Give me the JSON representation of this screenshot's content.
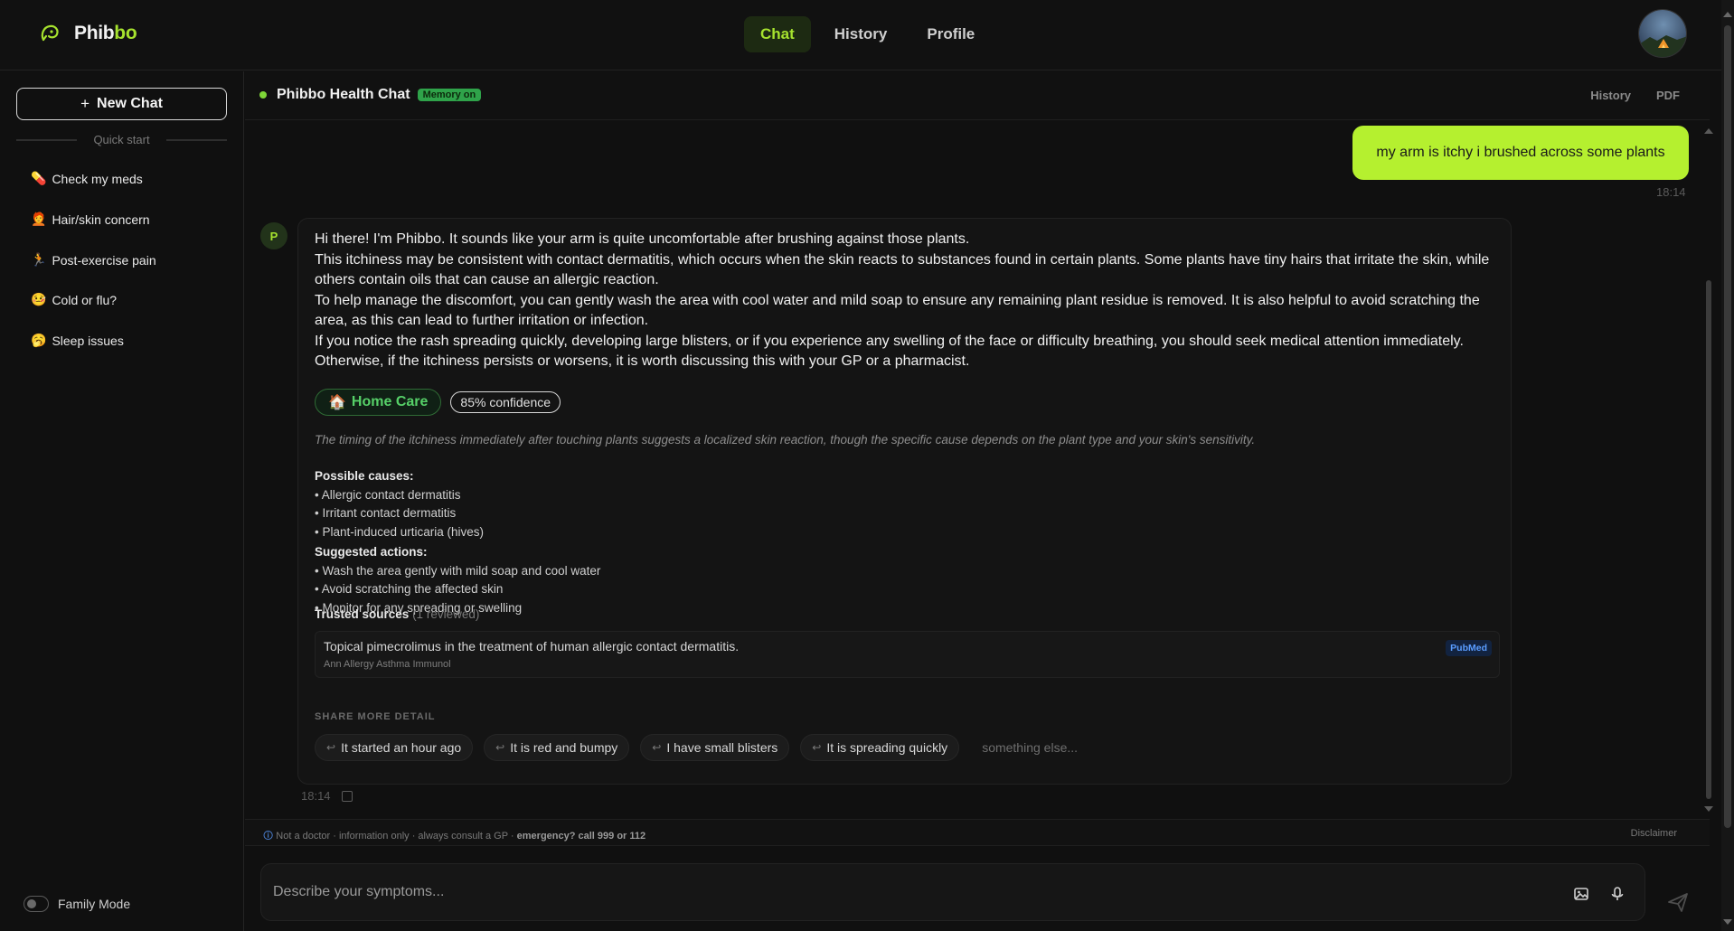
{
  "app": {
    "name_main": "Phib",
    "name_accent": "bo",
    "accent_color": "#a6e22e"
  },
  "nav": {
    "tabs": [
      {
        "label": "Chat",
        "active": true
      },
      {
        "label": "History",
        "active": false
      },
      {
        "label": "Profile",
        "active": false
      }
    ]
  },
  "sidebar": {
    "new_chat_label": "New Chat",
    "quick_start_label": "Quick start",
    "items": [
      {
        "emoji": "💊",
        "label": "Check my meds"
      },
      {
        "emoji": "🧑‍🦰",
        "label": "Hair/skin concern"
      },
      {
        "emoji": "🏃",
        "label": "Post-exercise pain"
      },
      {
        "emoji": "🤒",
        "label": "Cold or flu?"
      },
      {
        "emoji": "🥱",
        "label": "Sleep issues"
      }
    ],
    "family_mode_label": "Family Mode"
  },
  "chat_header": {
    "title": "Phibbo Health Chat",
    "memory_badge": "Memory on",
    "links": [
      "History",
      "PDF"
    ]
  },
  "user_message": {
    "text": "my arm is itchy i brushed across some plants",
    "time": "18:14"
  },
  "bot_message": {
    "avatar_letter": "P",
    "paragraphs": [
      "Hi there! I'm Phibbo. It sounds like your arm is quite uncomfortable after brushing against those plants.",
      "This itchiness may be consistent with contact dermatitis, which occurs when the skin reacts to substances found in certain plants. Some plants have tiny hairs that irritate the skin, while others contain oils that can cause an allergic reaction.",
      "To help manage the discomfort, you can gently wash the area with cool water and mild soap to ensure any remaining plant residue is removed. It is also helpful to avoid scratching the area, as this can lead to further irritation or infection.",
      "If you notice the rash spreading quickly, developing large blisters, or if you experience any swelling of the face or difficulty breathing, you should seek medical attention immediately. Otherwise, if the itchiness persists or worsens, it is worth discussing this with your GP or a pharmacist."
    ],
    "care_badge": "Home Care",
    "confidence_badge": "85% confidence",
    "note": "The timing of the itchiness immediately after touching plants suggests a localized skin reaction, though the specific cause depends on the plant type and your skin's sensitivity.",
    "causes_label": "Possible causes:",
    "causes": [
      "• Allergic contact dermatitis",
      "• Irritant contact dermatitis",
      "• Plant-induced urticaria (hives)"
    ],
    "actions_label": "Suggested actions:",
    "actions": [
      "• Wash the area gently with mild soap and cool water",
      "• Avoid scratching the affected skin",
      "• Monitor for any spreading or swelling"
    ],
    "sources_label": "Trusted sources",
    "sources_sub": "(1 reviewed)",
    "source": {
      "title": "Topical pimecrolimus in the treatment of human allergic contact dermatitis.",
      "journal": "Ann Allergy Asthma Immunol",
      "tag": "PubMed"
    },
    "share_label": "SHARE MORE DETAIL",
    "chips": [
      "It started an hour ago",
      "It is red and bumpy",
      "I have small blisters",
      "It is spreading quickly"
    ],
    "chip_other": "something else...",
    "time": "18:14"
  },
  "disclaimer": {
    "text": "Not a doctor · information only · always consult a GP · ",
    "emphasis": "emergency? call 999 or 112",
    "link": "Disclaimer"
  },
  "composer": {
    "placeholder": "Describe your symptoms..."
  }
}
